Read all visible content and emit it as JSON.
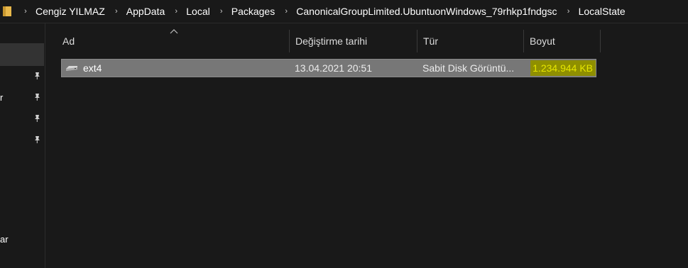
{
  "address_bar": {
    "breadcrumbs": [
      "Cengiz YILMAZ",
      "AppData",
      "Local",
      "Packages",
      "CanonicalGroupLimited.UbuntuonWindows_79rhkp1fndgsc",
      "LocalState"
    ],
    "separator_glyph": "›"
  },
  "nav_pane": {
    "fragments": [
      "r",
      "ar"
    ],
    "pin_icon": "pin-icon"
  },
  "columns": {
    "name": "Ad",
    "date": "Değiştirme tarihi",
    "type": "Tür",
    "size": "Boyut"
  },
  "files": [
    {
      "name": "ext4",
      "modified": "13.04.2021 20:51",
      "type": "Sabit Disk Görüntü...",
      "size": "1.234.944 KB",
      "icon": "disk-image-icon"
    }
  ],
  "colors": {
    "background": "#191919",
    "selection": "#777777",
    "size_highlight_bg": "#8f8f00",
    "size_highlight_text": "#e6e600",
    "folder_icon": "#e8b84b"
  }
}
